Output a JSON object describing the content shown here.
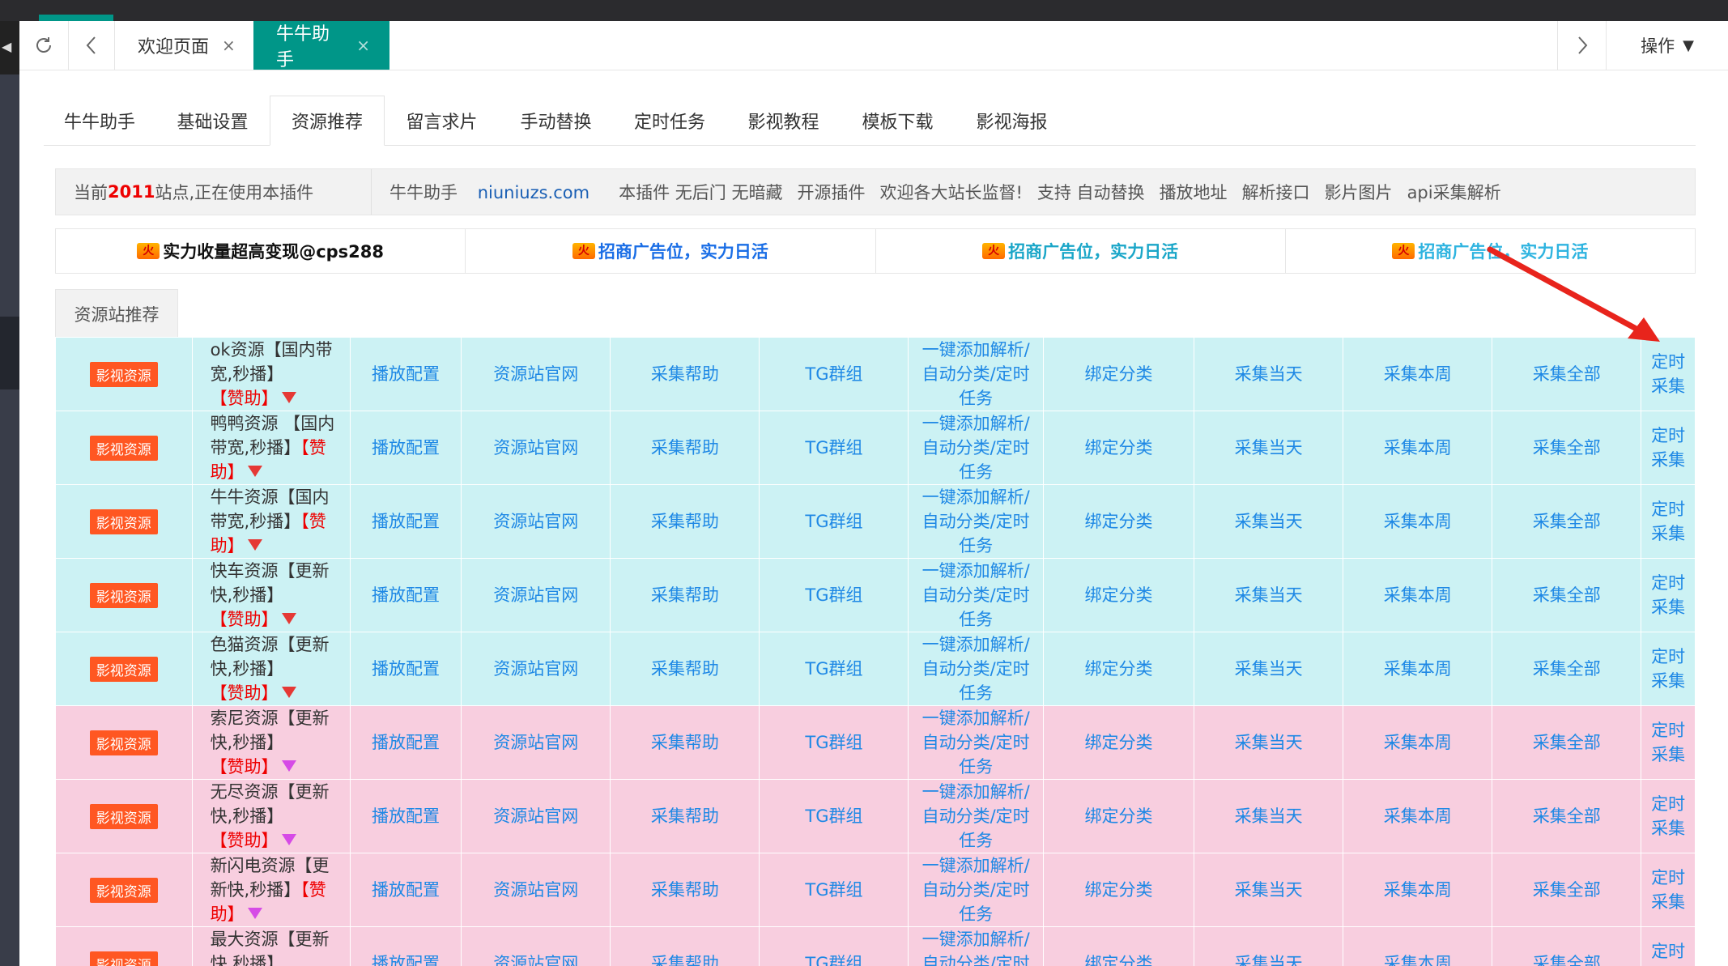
{
  "tabs": {
    "welcome": "欢迎页面",
    "active": "牛牛助手",
    "close": "×",
    "ops": "操作"
  },
  "subtabs": [
    {
      "label": "牛牛助手"
    },
    {
      "label": "基础设置"
    },
    {
      "label": "资源推荐",
      "active": true
    },
    {
      "label": "留言求片"
    },
    {
      "label": "手动替换"
    },
    {
      "label": "定时任务"
    },
    {
      "label": "影视教程"
    },
    {
      "label": "模板下载"
    },
    {
      "label": "影视海报"
    }
  ],
  "info": {
    "prefix": "当前",
    "count": "2011",
    "suffix": "站点,正在使用本插件",
    "brand": "牛牛助手",
    "site": "niuniuzs.com",
    "items": [
      "本插件 无后门 无暗藏",
      "开源插件",
      "欢迎各大站长监督!",
      "支持 自动替换",
      "播放地址",
      "解析接口",
      "影片图片",
      "api采集解析"
    ]
  },
  "ads": [
    "实力收量超高变现@cps288",
    "招商广告位，实力日活",
    "招商广告位，实力日活",
    "招商广告位，实力日活"
  ],
  "fire_glyph": "火",
  "resources_tab": "资源站推荐",
  "row_tag": "影视资源",
  "sponsor": "【赞助】",
  "actions": [
    "播放配置",
    "资源站官网",
    "采集帮助",
    "TG群组",
    "一键添加解析/自动分类/定时任务",
    "绑定分类",
    "采集当天",
    "采集本周",
    "采集全部",
    "定时采集"
  ],
  "rows": [
    {
      "name": "ok资源【国内带宽,秒播】",
      "color": "cyan",
      "gem": "red"
    },
    {
      "name": "鸭鸭资源 【国内带宽,秒播】",
      "color": "cyan",
      "gem": "red"
    },
    {
      "name": "牛牛资源【国内带宽,秒播】",
      "color": "cyan",
      "gem": "red"
    },
    {
      "name": "快车资源【更新快,秒播】",
      "color": "cyan",
      "gem": "red"
    },
    {
      "name": "色猫资源【更新快,秒播】",
      "color": "cyan",
      "gem": "red"
    },
    {
      "name": "索尼资源【更新快,秒播】",
      "color": "pink",
      "gem": "purple"
    },
    {
      "name": "无尽资源【更新快,秒播】",
      "color": "pink",
      "gem": "purple"
    },
    {
      "name": "新闪电资源【更新快,秒播】",
      "color": "pink",
      "gem": "purple"
    },
    {
      "name": "最大资源【更新快,秒播】",
      "color": "pink",
      "gem": "purple"
    }
  ],
  "colors": {
    "accent": "#009688",
    "tag": "#ff5722",
    "link": "#1e88e5",
    "row_cyan": "#ccf2f4",
    "row_pink": "#f8cedf",
    "arrow": "#e8241c"
  }
}
